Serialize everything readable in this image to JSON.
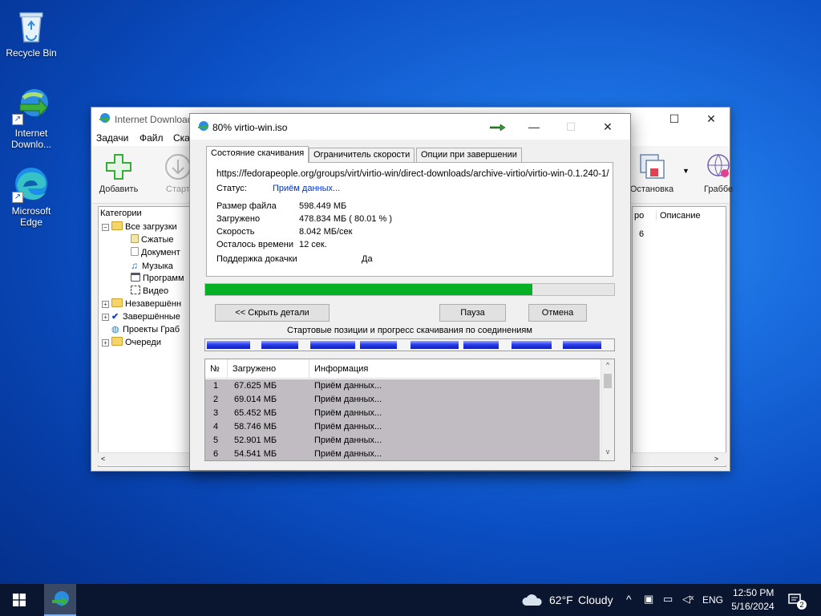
{
  "desktop": {
    "icons": [
      {
        "label": "Recycle Bin"
      },
      {
        "label": "Internet Downlo..."
      },
      {
        "label": "Microsoft Edge"
      }
    ]
  },
  "idm_main": {
    "title": "Internet Download",
    "menu": [
      "Задачи",
      "Файл",
      "Ска"
    ],
    "toolbar": {
      "add": "Добавить",
      "start": "Старт",
      "stop": "Остановка",
      "grabber": "Граббе"
    },
    "tree": {
      "header": "Категории",
      "all": "Все загрузки",
      "compressed": "Сжатые",
      "documents": "Документ",
      "music": "Музыка",
      "programs": "Программ",
      "video": "Видео",
      "unfinished": "Незавершённ",
      "finished": "Завершённые",
      "grabber_projects": "Проекты Граб",
      "queues": "Очереди"
    },
    "columns": {
      "col_partial": "ро",
      "description": "Описание",
      "cell_partial": "6"
    }
  },
  "dialog": {
    "title": "80% virtio-win.iso",
    "tabs": [
      "Состояние скачивания",
      "Ограничитель скорости",
      "Опции при завершении"
    ],
    "url": "https://fedorapeople.org/groups/virt/virtio-win/direct-downloads/archive-virtio/virtio-win-0.1.240-1/",
    "status_label": "Статус:",
    "status_value": "Приём данных...",
    "file_size_label": "Размер файла",
    "file_size_value": "598.449  МБ",
    "downloaded_label": "Загружено",
    "downloaded_value": "478.834  МБ  ( 80.01 % )",
    "speed_label": "Скорость",
    "speed_value": "8.042  МБ/сек",
    "time_left_label": "Осталось времени",
    "time_left_value": "12 сек.",
    "resume_label": "Поддержка докачки",
    "resume_value": "Да",
    "progress": 0.8001,
    "buttons": {
      "hide_details": "<< Скрыть детали",
      "pause": "Пауза",
      "cancel": "Отмена"
    },
    "connections_caption": "Стартовые позиции и прогресс скачивания по соединениям",
    "list_headers": {
      "num": "№",
      "downloaded": "Загружено",
      "info": "Информация"
    },
    "connections": [
      {
        "n": "1",
        "size": "67.625  МБ",
        "info": "Приём данных..."
      },
      {
        "n": "2",
        "size": "69.014  МБ",
        "info": "Приём данных..."
      },
      {
        "n": "3",
        "size": "65.452  МБ",
        "info": "Приём данных..."
      },
      {
        "n": "4",
        "size": "58.746  МБ",
        "info": "Приём данных..."
      },
      {
        "n": "5",
        "size": "52.901  МБ",
        "info": "Приём данных..."
      },
      {
        "n": "6",
        "size": "54.541  МБ",
        "info": "Приём данных..."
      }
    ]
  },
  "taskbar": {
    "weather_temp": "62°F",
    "weather_desc": "Cloudy",
    "language": "ENG",
    "time": "12:50 PM",
    "date": "5/16/2024",
    "notifications_count": "2"
  },
  "colors": {
    "progress_green": "#06b025",
    "taskbar": "#0a1530",
    "status_link": "#0033cc"
  }
}
